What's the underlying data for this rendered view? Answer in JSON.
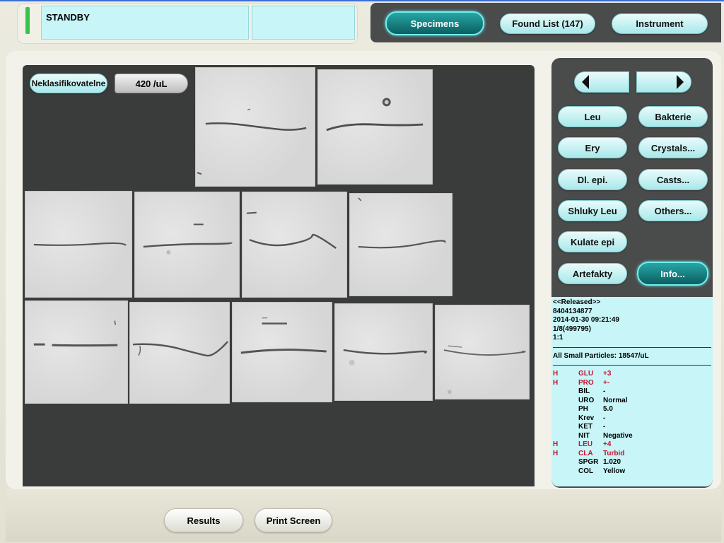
{
  "status": {
    "text": "STANDBY"
  },
  "nav": {
    "specimens": "Specimens",
    "found_list": "Found List (147)",
    "instrument": "Instrument"
  },
  "panel": {
    "class_label": "Neklasifikovatelne",
    "concentration": "420 /uL"
  },
  "categories": {
    "leu": "Leu",
    "bakterie": "Bakterie",
    "ery": "Ery",
    "crystals": "Crystals...",
    "dl_epi": "Dl. epi.",
    "casts": "Casts...",
    "shluky_leu": "Shluky Leu",
    "others": "Others...",
    "kulate_epi": "Kulate epi",
    "artefakty": "Artefakty",
    "info": "Info..."
  },
  "sample": {
    "state": "<<Released>>",
    "id": "8404134877",
    "datetime": "2014-01-30 09:21:49",
    "position": "1/8(499795)",
    "dilution": "1:1",
    "small_particles": "All Small Particles: 18547/uL"
  },
  "params": [
    {
      "flag": "H",
      "name": "GLU",
      "value": "+3",
      "abnormal": true
    },
    {
      "flag": "H",
      "name": "PRO",
      "value": "+-",
      "abnormal": true
    },
    {
      "flag": "",
      "name": "BIL",
      "value": "-",
      "abnormal": false
    },
    {
      "flag": "",
      "name": "URO",
      "value": "Normal",
      "abnormal": false
    },
    {
      "flag": "",
      "name": "PH",
      "value": "5.0",
      "abnormal": false
    },
    {
      "flag": "",
      "name": "Krev",
      "value": "-",
      "abnormal": false
    },
    {
      "flag": "",
      "name": "KET",
      "value": "-",
      "abnormal": false
    },
    {
      "flag": "",
      "name": "NIT",
      "value": "Negative",
      "abnormal": false
    },
    {
      "flag": "H",
      "name": "LEU",
      "value": "+4",
      "abnormal": true
    },
    {
      "flag": "H",
      "name": "CLA",
      "value": "Turbid",
      "abnormal": true
    },
    {
      "flag": "",
      "name": "SPGR",
      "value": "1.020",
      "abnormal": false
    },
    {
      "flag": "",
      "name": "COL",
      "value": "Yellow",
      "abnormal": false
    }
  ],
  "bottom": {
    "results": "Results",
    "print_screen": "Print Screen"
  }
}
